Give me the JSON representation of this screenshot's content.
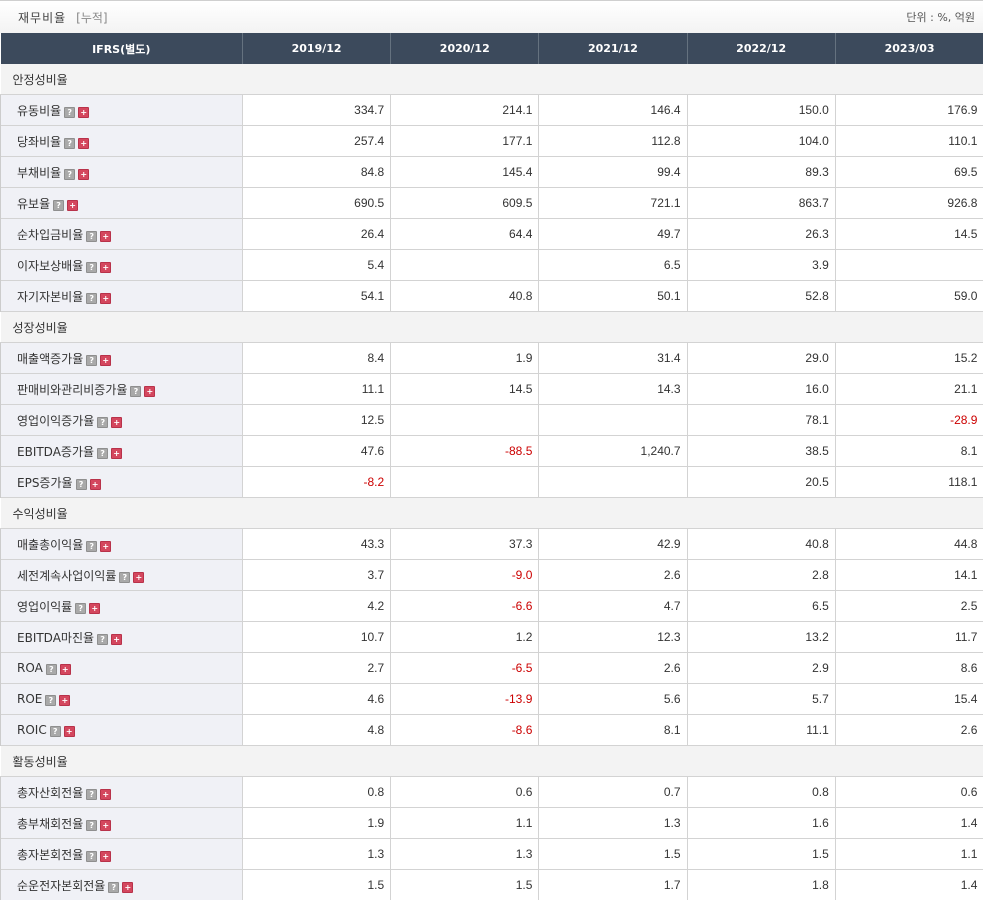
{
  "header": {
    "title": "재무비율",
    "subtitle": "[누적]",
    "unit": "단위 : %, 억원"
  },
  "columns": [
    "IFRS(별도)",
    "2019/12",
    "2020/12",
    "2021/12",
    "2022/12",
    "2023/03"
  ],
  "help_icon_glyph": "?",
  "expand_icon_glyph": "+",
  "icons": {
    "help": "question-icon",
    "expand": "plus-icon"
  },
  "colors": {
    "header_bg": "#3c4a5c",
    "negative": "#cc0000",
    "label_bg": "#f0f1f6"
  },
  "sections": [
    {
      "name": "안정성비율",
      "rows": [
        {
          "label": "유동비율",
          "values": [
            "334.7",
            "214.1",
            "146.4",
            "150.0",
            "176.9"
          ]
        },
        {
          "label": "당좌비율",
          "values": [
            "257.4",
            "177.1",
            "112.8",
            "104.0",
            "110.1"
          ]
        },
        {
          "label": "부채비율",
          "values": [
            "84.8",
            "145.4",
            "99.4",
            "89.3",
            "69.5"
          ]
        },
        {
          "label": "유보율",
          "values": [
            "690.5",
            "609.5",
            "721.1",
            "863.7",
            "926.8"
          ]
        },
        {
          "label": "순차입금비율",
          "values": [
            "26.4",
            "64.4",
            "49.7",
            "26.3",
            "14.5"
          ]
        },
        {
          "label": "이자보상배율",
          "values": [
            "5.4",
            "",
            "6.5",
            "3.9",
            ""
          ]
        },
        {
          "label": "자기자본비율",
          "values": [
            "54.1",
            "40.8",
            "50.1",
            "52.8",
            "59.0"
          ]
        }
      ]
    },
    {
      "name": "성장성비율",
      "rows": [
        {
          "label": "매출액증가율",
          "values": [
            "8.4",
            "1.9",
            "31.4",
            "29.0",
            "15.2"
          ]
        },
        {
          "label": "판매비와관리비증가율",
          "values": [
            "11.1",
            "14.5",
            "14.3",
            "16.0",
            "21.1"
          ]
        },
        {
          "label": "영업이익증가율",
          "values": [
            "12.5",
            "",
            "",
            "78.1",
            "-28.9"
          ]
        },
        {
          "label": "EBITDA증가율",
          "values": [
            "47.6",
            "-88.5",
            "1,240.7",
            "38.5",
            "8.1"
          ]
        },
        {
          "label": "EPS증가율",
          "values": [
            "-8.2",
            "",
            "",
            "20.5",
            "118.1"
          ]
        }
      ]
    },
    {
      "name": "수익성비율",
      "rows": [
        {
          "label": "매출총이익율",
          "values": [
            "43.3",
            "37.3",
            "42.9",
            "40.8",
            "44.8"
          ]
        },
        {
          "label": "세전계속사업이익률",
          "values": [
            "3.7",
            "-9.0",
            "2.6",
            "2.8",
            "14.1"
          ]
        },
        {
          "label": "영업이익률",
          "values": [
            "4.2",
            "-6.6",
            "4.7",
            "6.5",
            "2.5"
          ]
        },
        {
          "label": "EBITDA마진율",
          "values": [
            "10.7",
            "1.2",
            "12.3",
            "13.2",
            "11.7"
          ]
        },
        {
          "label": "ROA",
          "values": [
            "2.7",
            "-6.5",
            "2.6",
            "2.9",
            "8.6"
          ]
        },
        {
          "label": "ROE",
          "values": [
            "4.6",
            "-13.9",
            "5.6",
            "5.7",
            "15.4"
          ]
        },
        {
          "label": "ROIC",
          "values": [
            "4.8",
            "-8.6",
            "8.1",
            "11.1",
            "2.6"
          ]
        }
      ]
    },
    {
      "name": "활동성비율",
      "rows": [
        {
          "label": "총자산회전율",
          "values": [
            "0.8",
            "0.6",
            "0.7",
            "0.8",
            "0.6"
          ]
        },
        {
          "label": "총부채회전율",
          "values": [
            "1.9",
            "1.1",
            "1.3",
            "1.6",
            "1.4"
          ]
        },
        {
          "label": "총자본회전율",
          "values": [
            "1.3",
            "1.3",
            "1.5",
            "1.5",
            "1.1"
          ]
        },
        {
          "label": "순운전자본회전율",
          "values": [
            "1.5",
            "1.5",
            "1.7",
            "1.8",
            "1.4"
          ]
        }
      ]
    }
  ]
}
